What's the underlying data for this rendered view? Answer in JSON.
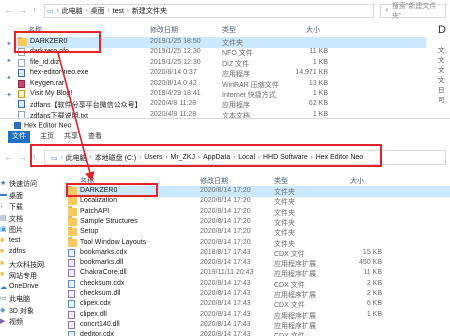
{
  "top_window": {
    "breadcrumb": [
      "此电脑",
      "桌面",
      "test",
      "新建文件夹"
    ],
    "search_placeholder": "搜索\"新建文件夹\"",
    "columns": {
      "name": "名称",
      "date": "修改日期",
      "type": "类型",
      "size": "大小"
    },
    "right_letter": "D",
    "right_prefixes": [
      "文",
      "文",
      "文",
      "文",
      "日",
      "可"
    ],
    "files": [
      {
        "name": "DARKZER0",
        "date": "2019/1/25 18:50",
        "type": "文件夹",
        "size": "",
        "icon": "folder"
      },
      {
        "name": "darkzero.nfo",
        "date": "2019/1/25 12:30",
        "type": "NFO 文件",
        "size": "11 KB",
        "icon": "file"
      },
      {
        "name": "file_id.diz",
        "date": "2019/1/25 12:30",
        "type": "DIZ 文件",
        "size": "1 KB",
        "icon": "file"
      },
      {
        "name": "hex-editor-neo.exe",
        "date": "2020/8/14 0:37",
        "type": "应用程序",
        "size": "14,971 KB",
        "icon": "exe"
      },
      {
        "name": "Keygen.rar",
        "date": "2020/8/14 0:42",
        "type": "WinRAR 压缩文件",
        "size": "13 KB",
        "icon": "rar"
      },
      {
        "name": "Visit My Blog!",
        "date": "2018/4/29 18:41",
        "type": "Internet 快捷方式",
        "size": "1 KB",
        "icon": "html"
      },
      {
        "name": "zdfans【软件分享平台微信公众号】",
        "date": "2020/4/8 11:28",
        "type": "应用程序",
        "size": "62 KB",
        "icon": "exe"
      },
      {
        "name": "zdfans下载说明.txt",
        "date": "2020/4/8 11:28",
        "type": "文本文档",
        "size": "1 KB",
        "icon": "file"
      }
    ]
  },
  "bottom_window": {
    "title": "Hex Editor Neo",
    "ribbon": [
      "文件",
      "主页",
      "共享",
      "查看"
    ],
    "breadcrumb": [
      "此电脑",
      "本地磁盘 (C:)",
      "Users",
      "Mr_ZKJ",
      "AppData",
      "Local",
      "HHD Software",
      "Hex Editor Neo"
    ],
    "columns": {
      "name": "名称",
      "date": "修改日期",
      "type": "类型",
      "size": "大小"
    },
    "sidebar": [
      {
        "label": "快速访问",
        "icon": "star"
      },
      {
        "label": "桌面",
        "icon": "desktop"
      },
      {
        "label": "下载",
        "icon": "download"
      },
      {
        "label": "文档",
        "icon": "doc"
      },
      {
        "label": "图片",
        "icon": "pic"
      },
      {
        "label": "test",
        "icon": "folder"
      },
      {
        "label": "zdfns",
        "icon": "folder"
      },
      {
        "label": "大众科技网",
        "icon": "folder"
      },
      {
        "label": "网站专用",
        "icon": "folder"
      },
      {
        "label": "OneDrive",
        "icon": "cloud"
      },
      {
        "label": "此电脑",
        "icon": "pc"
      },
      {
        "label": "3D 对象",
        "icon": "cube"
      },
      {
        "label": "视频",
        "icon": "video"
      }
    ],
    "files": [
      {
        "name": "DARKZER0",
        "date": "2020/8/14 17:20",
        "type": "文件夹",
        "size": "",
        "icon": "folder"
      },
      {
        "name": "Localization",
        "date": "2020/8/14 17:20",
        "type": "文件夹",
        "size": "",
        "icon": "folder"
      },
      {
        "name": "PatchAPI",
        "date": "2020/8/14 17:20",
        "type": "文件夹",
        "size": "",
        "icon": "folder"
      },
      {
        "name": "Sample Structures",
        "date": "2020/8/14 17:20",
        "type": "文件夹",
        "size": "",
        "icon": "folder"
      },
      {
        "name": "Setup",
        "date": "2020/8/14 17:20",
        "type": "文件夹",
        "size": "",
        "icon": "folder"
      },
      {
        "name": "Tool Window Layouts",
        "date": "2020/8/14 17:20",
        "type": "文件夹",
        "size": "",
        "icon": "folder"
      },
      {
        "name": "bookmarks.cdx",
        "date": "2018/8/17 17:43",
        "type": "CDX 文件",
        "size": "15 KB",
        "icon": "cdx"
      },
      {
        "name": "bookmarks.dll",
        "date": "2020/8/14 17:43",
        "type": "应用程序扩展",
        "size": "450 KB",
        "icon": "dll"
      },
      {
        "name": "ChakraCore.dll",
        "date": "2019/11/11 20:43",
        "type": "应用程序扩展",
        "size": "11 KB",
        "icon": "dll"
      },
      {
        "name": "checksum.cdx",
        "date": "2020/8/14 17:43",
        "type": "CDX 文件",
        "size": "2 KB",
        "icon": "cdx"
      },
      {
        "name": "checksum.dll",
        "date": "2020/8/14 17:43",
        "type": "应用程序扩展",
        "size": "2 KB",
        "icon": "dll"
      },
      {
        "name": "clipex.cdx",
        "date": "2020/8/14 17:43",
        "type": "CDX 文件",
        "size": "6 KB",
        "icon": "cdx"
      },
      {
        "name": "clipex.dll",
        "date": "2020/8/14 17:43",
        "type": "应用程序扩展",
        "size": "1 KB",
        "icon": "dll"
      },
      {
        "name": "concrt140.dll",
        "date": "2020/8/14 17:43",
        "type": "应用程序扩展",
        "size": "",
        "icon": "dll"
      },
      {
        "name": "deditor.cdx",
        "date": "2020/8/14 17:43",
        "type": "CDX 文件",
        "size": "",
        "icon": "cdx"
      }
    ]
  },
  "accent": "#e2232a"
}
